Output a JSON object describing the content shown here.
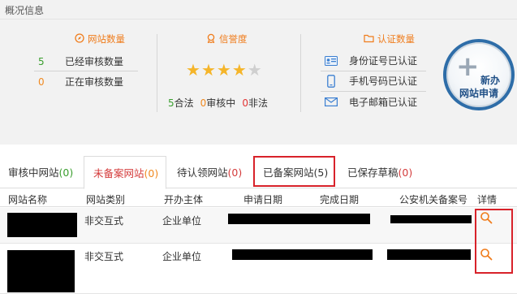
{
  "overview": {
    "title": "概况信息",
    "site_count": {
      "heading": "网站数量",
      "rows": [
        {
          "value": "5",
          "label": "已经审核数量"
        },
        {
          "value": "0",
          "label": "正在审核数量"
        }
      ]
    },
    "credit": {
      "heading": "信誉度",
      "stars_filled": 4,
      "stars_total": 5,
      "legal_count": "5",
      "legal_label": "合法",
      "reviewing_count": "0",
      "reviewing_label": "审核中",
      "illegal_count": "0",
      "illegal_label": "非法"
    },
    "certification": {
      "heading": "认证数量",
      "rows": [
        {
          "icon": "id-card-icon",
          "label": "身份证号已认证"
        },
        {
          "icon": "mobile-phone-icon",
          "label": "手机号码已认证"
        },
        {
          "icon": "envelope-icon",
          "label": "电子邮箱已认证"
        }
      ]
    },
    "new_site_button": {
      "line1": "新办",
      "line2": "网站申请"
    }
  },
  "tabs": [
    {
      "label": "审核中网站",
      "count": "(0)"
    },
    {
      "label": "未备案网站",
      "count": "(0)"
    },
    {
      "label": "待认领网站",
      "count": "(0)"
    },
    {
      "label": "已备案网站",
      "count": "(5)"
    },
    {
      "label": "已保存草稿",
      "count": "(0)"
    }
  ],
  "table": {
    "columns": [
      "网站名称",
      "网站类别",
      "开办主体",
      "申请日期",
      "完成日期",
      "公安机关备案号",
      "详情"
    ],
    "rows": [
      {
        "category": "非交互式",
        "owner": "企业单位"
      },
      {
        "category": "非交互式",
        "owner": "企业单位"
      }
    ]
  },
  "colors": {
    "accent_orange": "#f07c1b",
    "green": "#3a9e2e",
    "red": "#d43b3b",
    "highlight_red": "#d8222a",
    "button_blue": "#2e6da8"
  }
}
